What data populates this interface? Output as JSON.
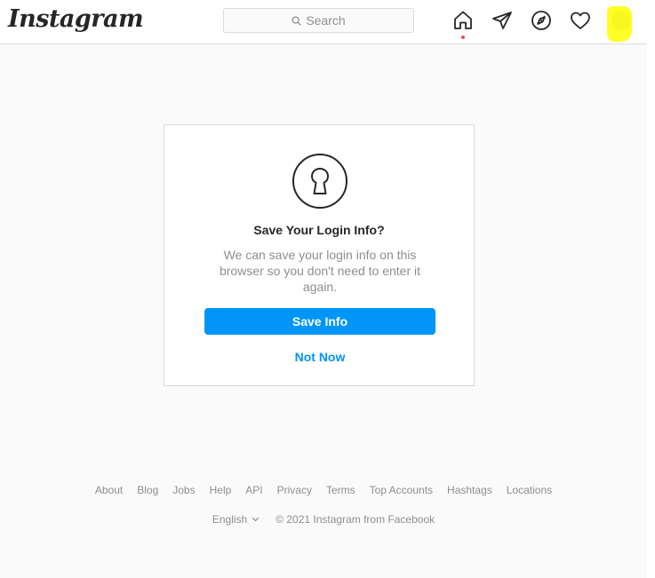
{
  "header": {
    "logo": "Instagram",
    "search_placeholder": "Search",
    "icons": [
      "home-icon",
      "direct-icon",
      "explore-icon",
      "activity-heart-icon",
      "profile-avatar"
    ]
  },
  "dialog": {
    "icon": "keyhole-lock-icon",
    "title": "Save Your Login Info?",
    "description": "We can save your login info on this browser so you don't need to enter it again.",
    "primary_button": "Save Info",
    "secondary_button": "Not Now"
  },
  "footer": {
    "links": [
      "About",
      "Blog",
      "Jobs",
      "Help",
      "API",
      "Privacy",
      "Terms",
      "Top Accounts",
      "Hashtags",
      "Locations"
    ],
    "language": "English",
    "copyright": "© 2021 Instagram from Facebook"
  },
  "colors": {
    "accent": "#0095f6",
    "background": "#fafafa",
    "border": "#dbdbdb",
    "notification_dot": "#ed4956",
    "highlight": "#ffff00"
  }
}
